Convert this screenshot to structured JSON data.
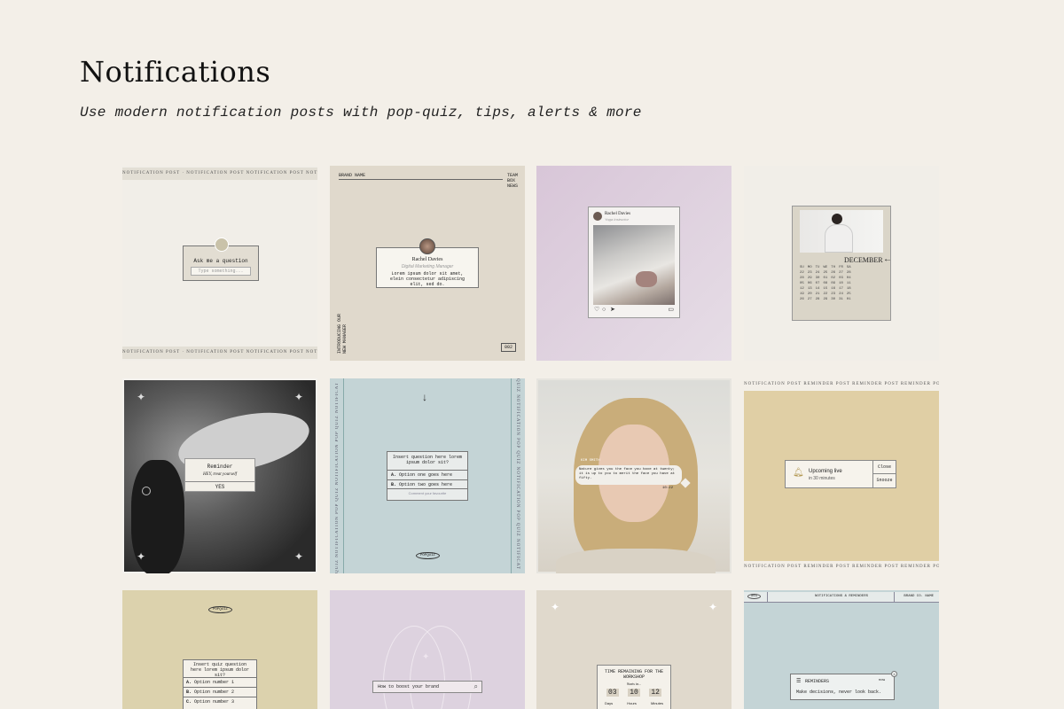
{
  "header": {
    "title": "Notifications",
    "subtitle": "Use modern notification posts with pop-quiz, tips, alerts & more"
  },
  "tile1": {
    "strip_text": "NOTIFICATION POST · NOTIFICATION POST NOTIFICATION POST NOTIFICATION",
    "prompt": "Ask me a question",
    "placeholder": "Type something..."
  },
  "tile2": {
    "brand": "BRAND NAME",
    "corner": "TEAM\nBOX\nNEWS",
    "name": "Rachel Davies",
    "role": "Digital Marketing Manager",
    "body": "Lorem ipsum dolor sit amet, elein consectetur adipiscing elit, sed do.",
    "page": "002",
    "side": "INTRODUCING OUR NEW MANAGER"
  },
  "tile3": {
    "name": "Rachel Davies",
    "role": "Yoga Instructor"
  },
  "tile4": {
    "month": "DECEMBER",
    "days": [
      "SU",
      "MO",
      "TU",
      "WE",
      "TH",
      "FR",
      "SA"
    ],
    "rows": [
      [
        "22",
        "23",
        "24",
        "25",
        "26",
        "27",
        "28"
      ],
      [
        "28",
        "29",
        "30",
        "01",
        "02",
        "03",
        "04"
      ],
      [
        "05",
        "06",
        "07",
        "08",
        "09",
        "10",
        "11"
      ],
      [
        "12",
        "13",
        "14",
        "15",
        "16",
        "17",
        "18"
      ],
      [
        "19",
        "20",
        "21",
        "22",
        "23",
        "24",
        "25"
      ],
      [
        "26",
        "27",
        "28",
        "29",
        "30",
        "31",
        "01"
      ]
    ]
  },
  "tile5": {
    "label": "Reminder",
    "message": "HEY, treat yourself",
    "button": "YES"
  },
  "tile6": {
    "question": "Insert question here lorem ipsum dolor sit?",
    "option_a": "Option one goes here",
    "option_b": "Option two goes here",
    "hint": "Comment your favourite",
    "tag": "POPQUIZ",
    "vertical": "QUIZ NOTIFICATION POP QUIZ NOTIFICATION POP QUIZ NOTIFICAT"
  },
  "tile7": {
    "name": "KIM SMITH",
    "message": "Nature gives you the face you have at twenty; it is up to you to merit the face you have at fifty.",
    "time": "10:22"
  },
  "tile8": {
    "strip_text": "NOTIFICATION POST REMINDER POST REMINDER POST REMINDER POST REMINDER",
    "title": "Upcoming live",
    "time": "in 30 minutes",
    "close": "Close",
    "snooze": "Snooze"
  },
  "tile9": {
    "tag": "POPQUIZ",
    "question": "Insert quiz question here lorem ipsum dolor sit?",
    "options": [
      "Option number 1",
      "Option number 2",
      "Option number 3"
    ]
  },
  "tile10": {
    "search_text": "How to boost your brand"
  },
  "tile11": {
    "title": "TIME REMAINING FOR THE WORKSHOP",
    "status": "Starts in...",
    "countdown": [
      "03",
      "10",
      "12"
    ],
    "units": [
      "Days",
      "Hours",
      "Minutes"
    ]
  },
  "tile12": {
    "badge": "001",
    "heading": "NOTIFICATIONS & REMINDERS",
    "brand": "BRAND CO. NAME",
    "label": "REMINDERS",
    "now": "now",
    "message": "Make decisions, never look back."
  },
  "colors": {
    "bg": "#f3efe8",
    "beige": "#e0d9cc",
    "lilac": "#ddd2df",
    "sage_blue": "#c4d4d6",
    "mustard": "#e0cfa5",
    "khaki": "#dcd2ad"
  }
}
